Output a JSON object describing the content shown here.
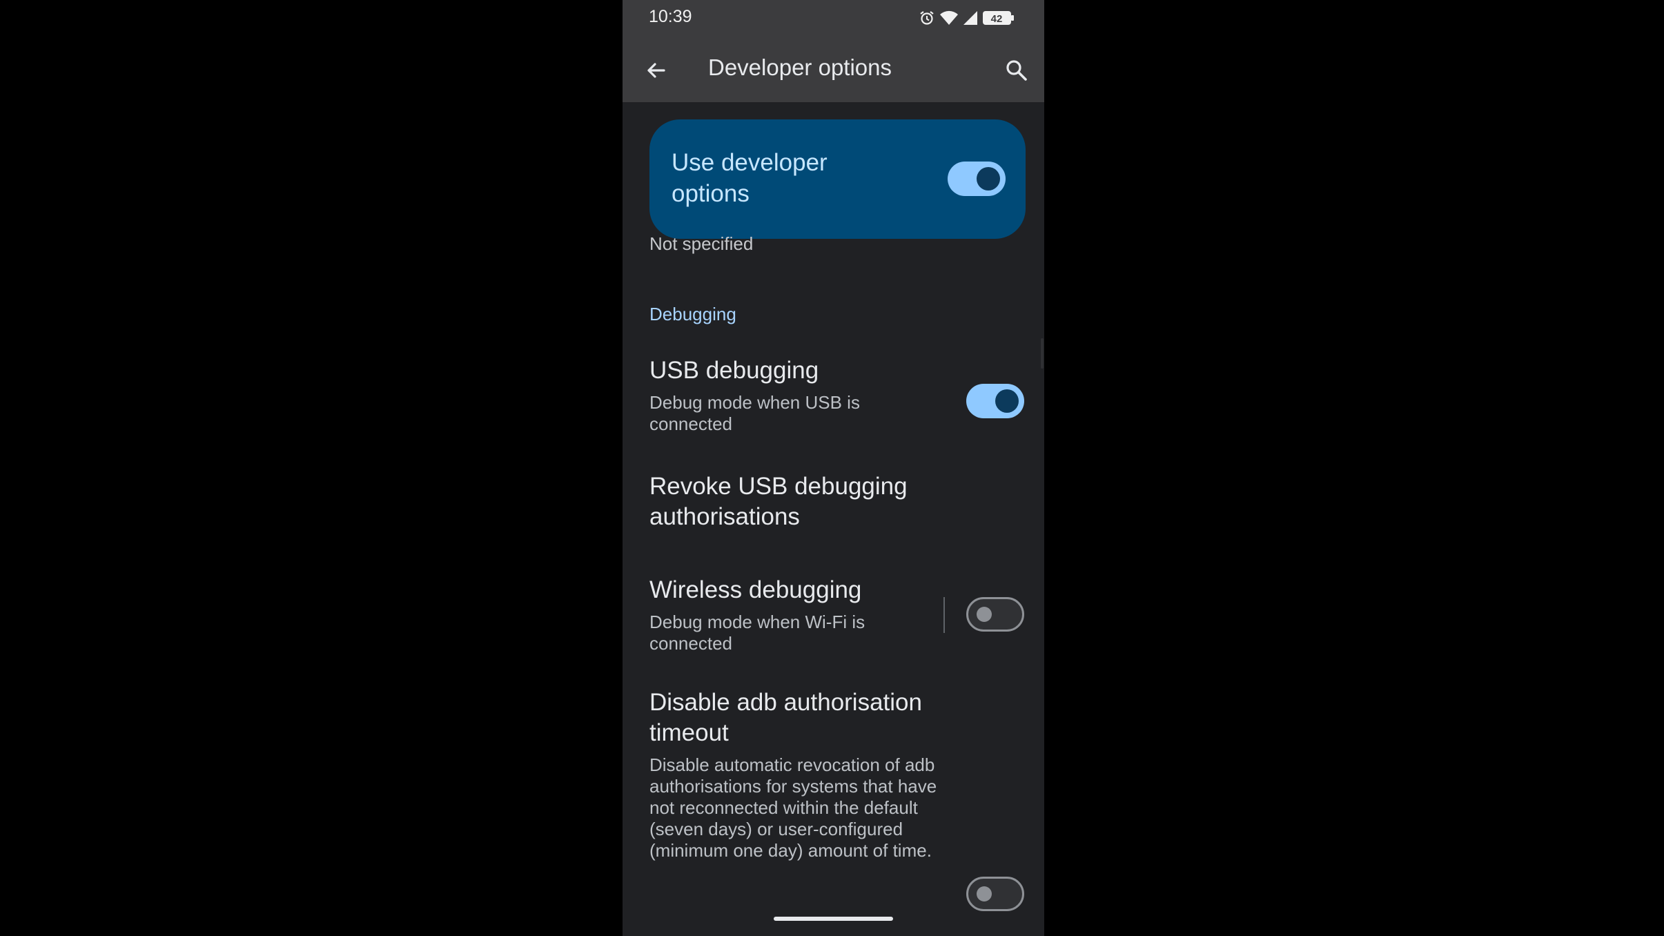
{
  "status": {
    "time": "10:39",
    "battery": "42"
  },
  "appbar": {
    "title": "Developer options"
  },
  "master": {
    "label": "Use developer options",
    "enabled": true
  },
  "under_text": "Not specified",
  "section": {
    "title": "Debugging"
  },
  "rows": {
    "usb": {
      "title": "USB debugging",
      "summary": "Debug mode when USB is connected",
      "enabled": true
    },
    "revoke": {
      "title": "Revoke USB debugging authorisations"
    },
    "wireless": {
      "title": "Wireless debugging",
      "summary": "Debug mode when Wi-Fi is connected",
      "enabled": false
    },
    "adb_timeout": {
      "title": "Disable adb authorisation timeout",
      "summary": "Disable automatic revocation of adb authorisations for systems that have not reconnected within the default (seven days) or user-configured (minimum one day) amount of time.",
      "enabled": false
    }
  },
  "colors": {
    "background": "#202124",
    "bar": "#3c3c3e",
    "card": "#004a77",
    "accent": "#8fc9ff",
    "section_text": "#a8d4ff"
  }
}
